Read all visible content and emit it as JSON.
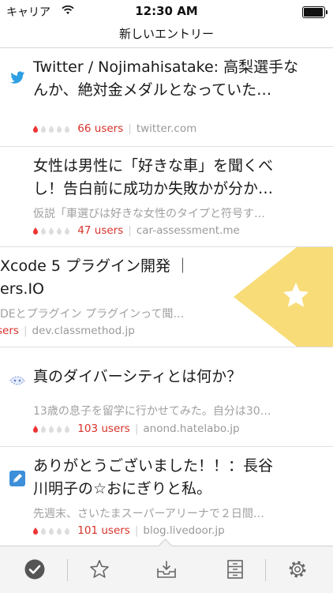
{
  "status_bar": {
    "carrier": "キャリア",
    "time": "12:30 AM",
    "battery_level": 1.0
  },
  "nav": {
    "title": "新しいエントリー"
  },
  "entries": [
    {
      "icon": "twitter-bird-icon",
      "title1": "Twitter / Nojimahisatake: 高梨選手な",
      "title2": "んか、絶対金メダルとなっていた…",
      "summary": "",
      "users": "66 users",
      "domain": "twitter.com"
    },
    {
      "icon": "blank-page-icon",
      "title1": "女性は男性に「好きな車」を聞くべ",
      "title2": "し！告白前に成功か失敗かが分か…",
      "summary": "仮説「車選びは好きな女性のタイプと符号す…",
      "users": "47 users",
      "domain": "car-assessment.me"
    },
    {
      "icon": "",
      "title1": "Xcode 5 プラグイン開発 ｜",
      "title2": "ers.IO",
      "summary": "DEとプラグイン プラグインって聞…",
      "users": "sers",
      "domain": "dev.classmethod.jp"
    },
    {
      "icon": "anond-icon",
      "title1": "真のダイバーシティとは何か？",
      "title2": "",
      "summary": "13歳の息子を留学に行かせてみた。自分は30…",
      "users": "103 users",
      "domain": "anond.hatelabo.jp"
    },
    {
      "icon": "livedoor-blog-icon",
      "title1": "ありがとうございました！！：長谷",
      "title2": "川明子の☆おにぎりと私。",
      "summary": "先週末、さいたまスーパーアリーナで２日間…",
      "users": "101 users",
      "domain": "blog.livedoor.jp"
    }
  ],
  "colors": {
    "users_red": "#d8322a",
    "swipe_yellow": "#f8dc78"
  },
  "toolbar": [
    "checkmark-icon",
    "star-icon",
    "inbox-download-icon",
    "cabinet-icon",
    "gear-icon"
  ]
}
